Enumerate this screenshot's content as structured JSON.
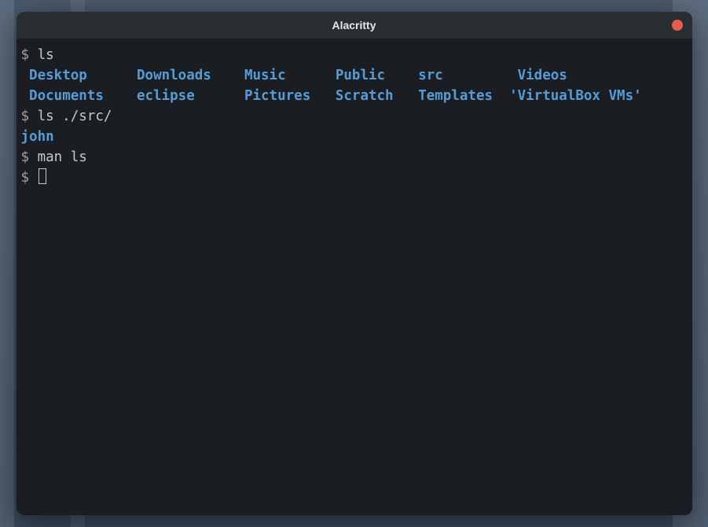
{
  "titlebar": {
    "title": "Alacritty"
  },
  "terminal": {
    "lines": [
      {
        "prompt": "$ ",
        "cmd": "ls"
      }
    ],
    "ls_output": {
      "row1": [
        {
          "name": "Desktop",
          "w": "13ch"
        },
        {
          "name": "Downloads",
          "w": "13ch"
        },
        {
          "name": "Music",
          "w": "11ch"
        },
        {
          "name": "Public",
          "w": "10ch"
        },
        {
          "name": "src",
          "w": "12ch"
        },
        {
          "name": "Videos",
          "w": "auto"
        }
      ],
      "row2": [
        {
          "name": "Documents",
          "w": "13ch"
        },
        {
          "name": "eclipse",
          "w": "13ch"
        },
        {
          "name": "Pictures",
          "w": "11ch"
        },
        {
          "name": "Scratch",
          "w": "10ch"
        },
        {
          "name": "Templates",
          "w": "11ch"
        },
        {
          "name": "'VirtualBox VMs'",
          "w": "auto"
        }
      ]
    },
    "line2": {
      "prompt": "$ ",
      "cmd": "ls ./src/"
    },
    "ls_src_output": "john",
    "line3": {
      "prompt": "$ ",
      "cmd": "man ls"
    },
    "line4": {
      "prompt": "$ "
    }
  },
  "colors": {
    "directory": "#569cd6",
    "prompt": "#a0a0a0",
    "text": "#c8c8c8",
    "bg": "#1a1d21",
    "titlebar_bg": "#2a2d31",
    "close_btn": "#e65c4f"
  }
}
